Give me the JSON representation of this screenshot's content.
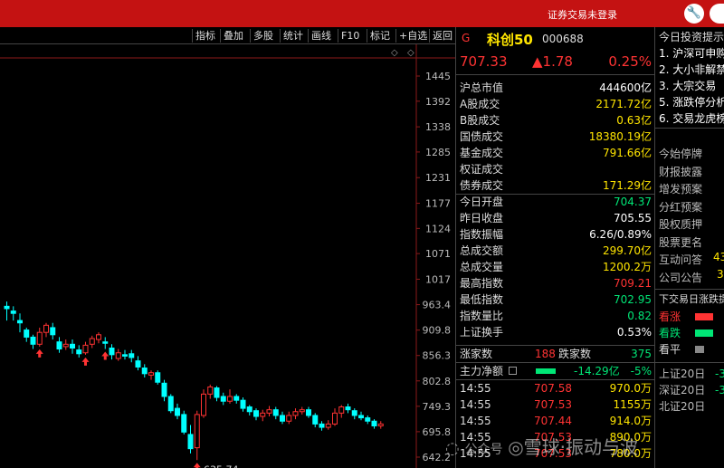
{
  "topbar": {
    "title": "证券交易未登录"
  },
  "toolbar": [
    "指标",
    "叠加",
    "多股",
    "统计",
    "画线",
    "F10",
    "标记",
    "+自选",
    "返回"
  ],
  "stock": {
    "marker": "G",
    "name": "科创50",
    "code": "000688",
    "price": "707.33",
    "change": "▲1.78",
    "pct": "0.25%"
  },
  "stats": [
    {
      "k": "沪总市值",
      "v": "444600亿",
      "c": "w"
    },
    {
      "k": "A股成交",
      "v": "2171.72亿",
      "c": "y"
    },
    {
      "k": "B股成交",
      "v": "0.63亿",
      "c": "y"
    },
    {
      "k": "国债成交",
      "v": "18380.19亿",
      "c": "y"
    },
    {
      "k": "基金成交",
      "v": "791.66亿",
      "c": "y"
    },
    {
      "k": "权证成交",
      "v": "",
      "c": "y"
    },
    {
      "k": "债券成交",
      "v": "171.29亿",
      "c": "y"
    },
    {
      "k": "今日开盘",
      "v": "704.37",
      "c": "g"
    },
    {
      "k": "昨日收盘",
      "v": "705.55",
      "c": "w"
    },
    {
      "k": "指数振幅",
      "v": "6.26/0.89%",
      "c": "w"
    },
    {
      "k": "总成交额",
      "v": "299.70亿",
      "c": "y"
    },
    {
      "k": "总成交量",
      "v": "1200.2万",
      "c": "y"
    },
    {
      "k": "最高指数",
      "v": "709.21",
      "c": "r"
    },
    {
      "k": "最低指数",
      "v": "702.95",
      "c": "g"
    },
    {
      "k": "指数量比",
      "v": "0.82",
      "c": "g"
    },
    {
      "k": "上证换手",
      "v": "0.53%",
      "c": "w"
    }
  ],
  "updown": {
    "up_label": "涨家数",
    "up": "188",
    "down_label": "跌家数",
    "down": "375"
  },
  "netflow": {
    "label": "主力净额",
    "value": "-14.29亿",
    "pct": "-5%"
  },
  "ticks": [
    {
      "t": "14:55",
      "p": "707.58",
      "v": "970.0万"
    },
    {
      "t": "14:55",
      "p": "707.53",
      "v": "1155万"
    },
    {
      "t": "14:55",
      "p": "707.44",
      "v": "914.0万"
    },
    {
      "t": "14:55",
      "p": "707.53",
      "v": "890.0万"
    },
    {
      "t": "14:55",
      "p": "707.53",
      "v": "780.0万"
    }
  ],
  "right_panel": {
    "header": "今日投资提示",
    "tips": [
      "1. 沪深可申购",
      "2. 大小非解禁",
      "3. 大宗交易",
      "5. 涨跌停分析",
      "6. 交易龙虎榜"
    ],
    "items": [
      "今始停牌",
      "财报披露",
      "增发预案",
      "分红预案",
      "股权质押",
      "股票更名",
      "互动问答",
      "公司公告"
    ],
    "interact_count": "43",
    "notice_count": "3",
    "next_header": "下交易日涨跌提示",
    "legend": [
      {
        "label": "看涨",
        "color": "#ff3333"
      },
      {
        "label": "看跌",
        "color": "#00e676"
      },
      {
        "label": "看平",
        "color": "#888888"
      }
    ],
    "markets": [
      "上证20日",
      "深证20日",
      "北证20日"
    ],
    "market_values": [
      "-3",
      "-3",
      ""
    ]
  },
  "chart_data": {
    "type": "candlestick",
    "y_ticks": [
      1445,
      1392,
      1338,
      1285,
      1231,
      1177,
      1124,
      1071,
      1017,
      963.4,
      909.8,
      856.3,
      802.8,
      749.3,
      695.8,
      642.2
    ],
    "ylim": [
      642.2,
      1445
    ],
    "low_label": "←635.74",
    "candles": [
      [
        960,
        955,
        970,
        930
      ],
      [
        950,
        945,
        960,
        930
      ],
      [
        930,
        925,
        945,
        905
      ],
      [
        910,
        895,
        915,
        885
      ],
      [
        895,
        880,
        900,
        870
      ],
      [
        880,
        905,
        915,
        875
      ],
      [
        905,
        920,
        925,
        895
      ],
      [
        915,
        900,
        925,
        890
      ],
      [
        885,
        870,
        895,
        862
      ],
      [
        875,
        880,
        890,
        868
      ],
      [
        880,
        872,
        890,
        860
      ],
      [
        868,
        860,
        878,
        852
      ],
      [
        862,
        878,
        885,
        858
      ],
      [
        880,
        892,
        898,
        872
      ],
      [
        890,
        900,
        905,
        882
      ],
      [
        885,
        882,
        895,
        870
      ],
      [
        872,
        858,
        880,
        848
      ],
      [
        850,
        862,
        870,
        845
      ],
      [
        858,
        855,
        868,
        848
      ],
      [
        860,
        852,
        868,
        842
      ],
      [
        845,
        832,
        855,
        825
      ],
      [
        830,
        818,
        838,
        810
      ],
      [
        815,
        820,
        825,
        805
      ],
      [
        820,
        800,
        825,
        795
      ],
      [
        798,
        770,
        805,
        760
      ],
      [
        770,
        740,
        775,
        735
      ],
      [
        745,
        730,
        755,
        722
      ],
      [
        732,
        695,
        740,
        690
      ],
      [
        690,
        660,
        710,
        650
      ],
      [
        662,
        732,
        740,
        636
      ],
      [
        730,
        775,
        785,
        725
      ],
      [
        775,
        790,
        795,
        765
      ],
      [
        788,
        768,
        792,
        760
      ],
      [
        770,
        760,
        778,
        752
      ],
      [
        760,
        770,
        785,
        755
      ],
      [
        770,
        762,
        775,
        755
      ],
      [
        762,
        745,
        768,
        738
      ],
      [
        748,
        738,
        752,
        730
      ],
      [
        740,
        728,
        745,
        720
      ],
      [
        728,
        735,
        742,
        718
      ],
      [
        735,
        742,
        750,
        728
      ],
      [
        742,
        730,
        748,
        722
      ],
      [
        730,
        718,
        738,
        712
      ],
      [
        718,
        730,
        738,
        712
      ],
      [
        730,
        738,
        745,
        722
      ],
      [
        738,
        742,
        748,
        732
      ],
      [
        742,
        730,
        748,
        725
      ],
      [
        730,
        712,
        735,
        705
      ],
      [
        712,
        705,
        718,
        698
      ],
      [
        705,
        712,
        720,
        700
      ],
      [
        712,
        735,
        745,
        708
      ],
      [
        735,
        748,
        752,
        725
      ],
      [
        748,
        742,
        755,
        735
      ],
      [
        740,
        730,
        745,
        722
      ],
      [
        730,
        725,
        738,
        720
      ],
      [
        725,
        718,
        730,
        712
      ],
      [
        718,
        708,
        722,
        702
      ],
      [
        708,
        712,
        718,
        702
      ]
    ],
    "up_arrows": [
      5,
      12,
      15,
      29
    ]
  }
}
